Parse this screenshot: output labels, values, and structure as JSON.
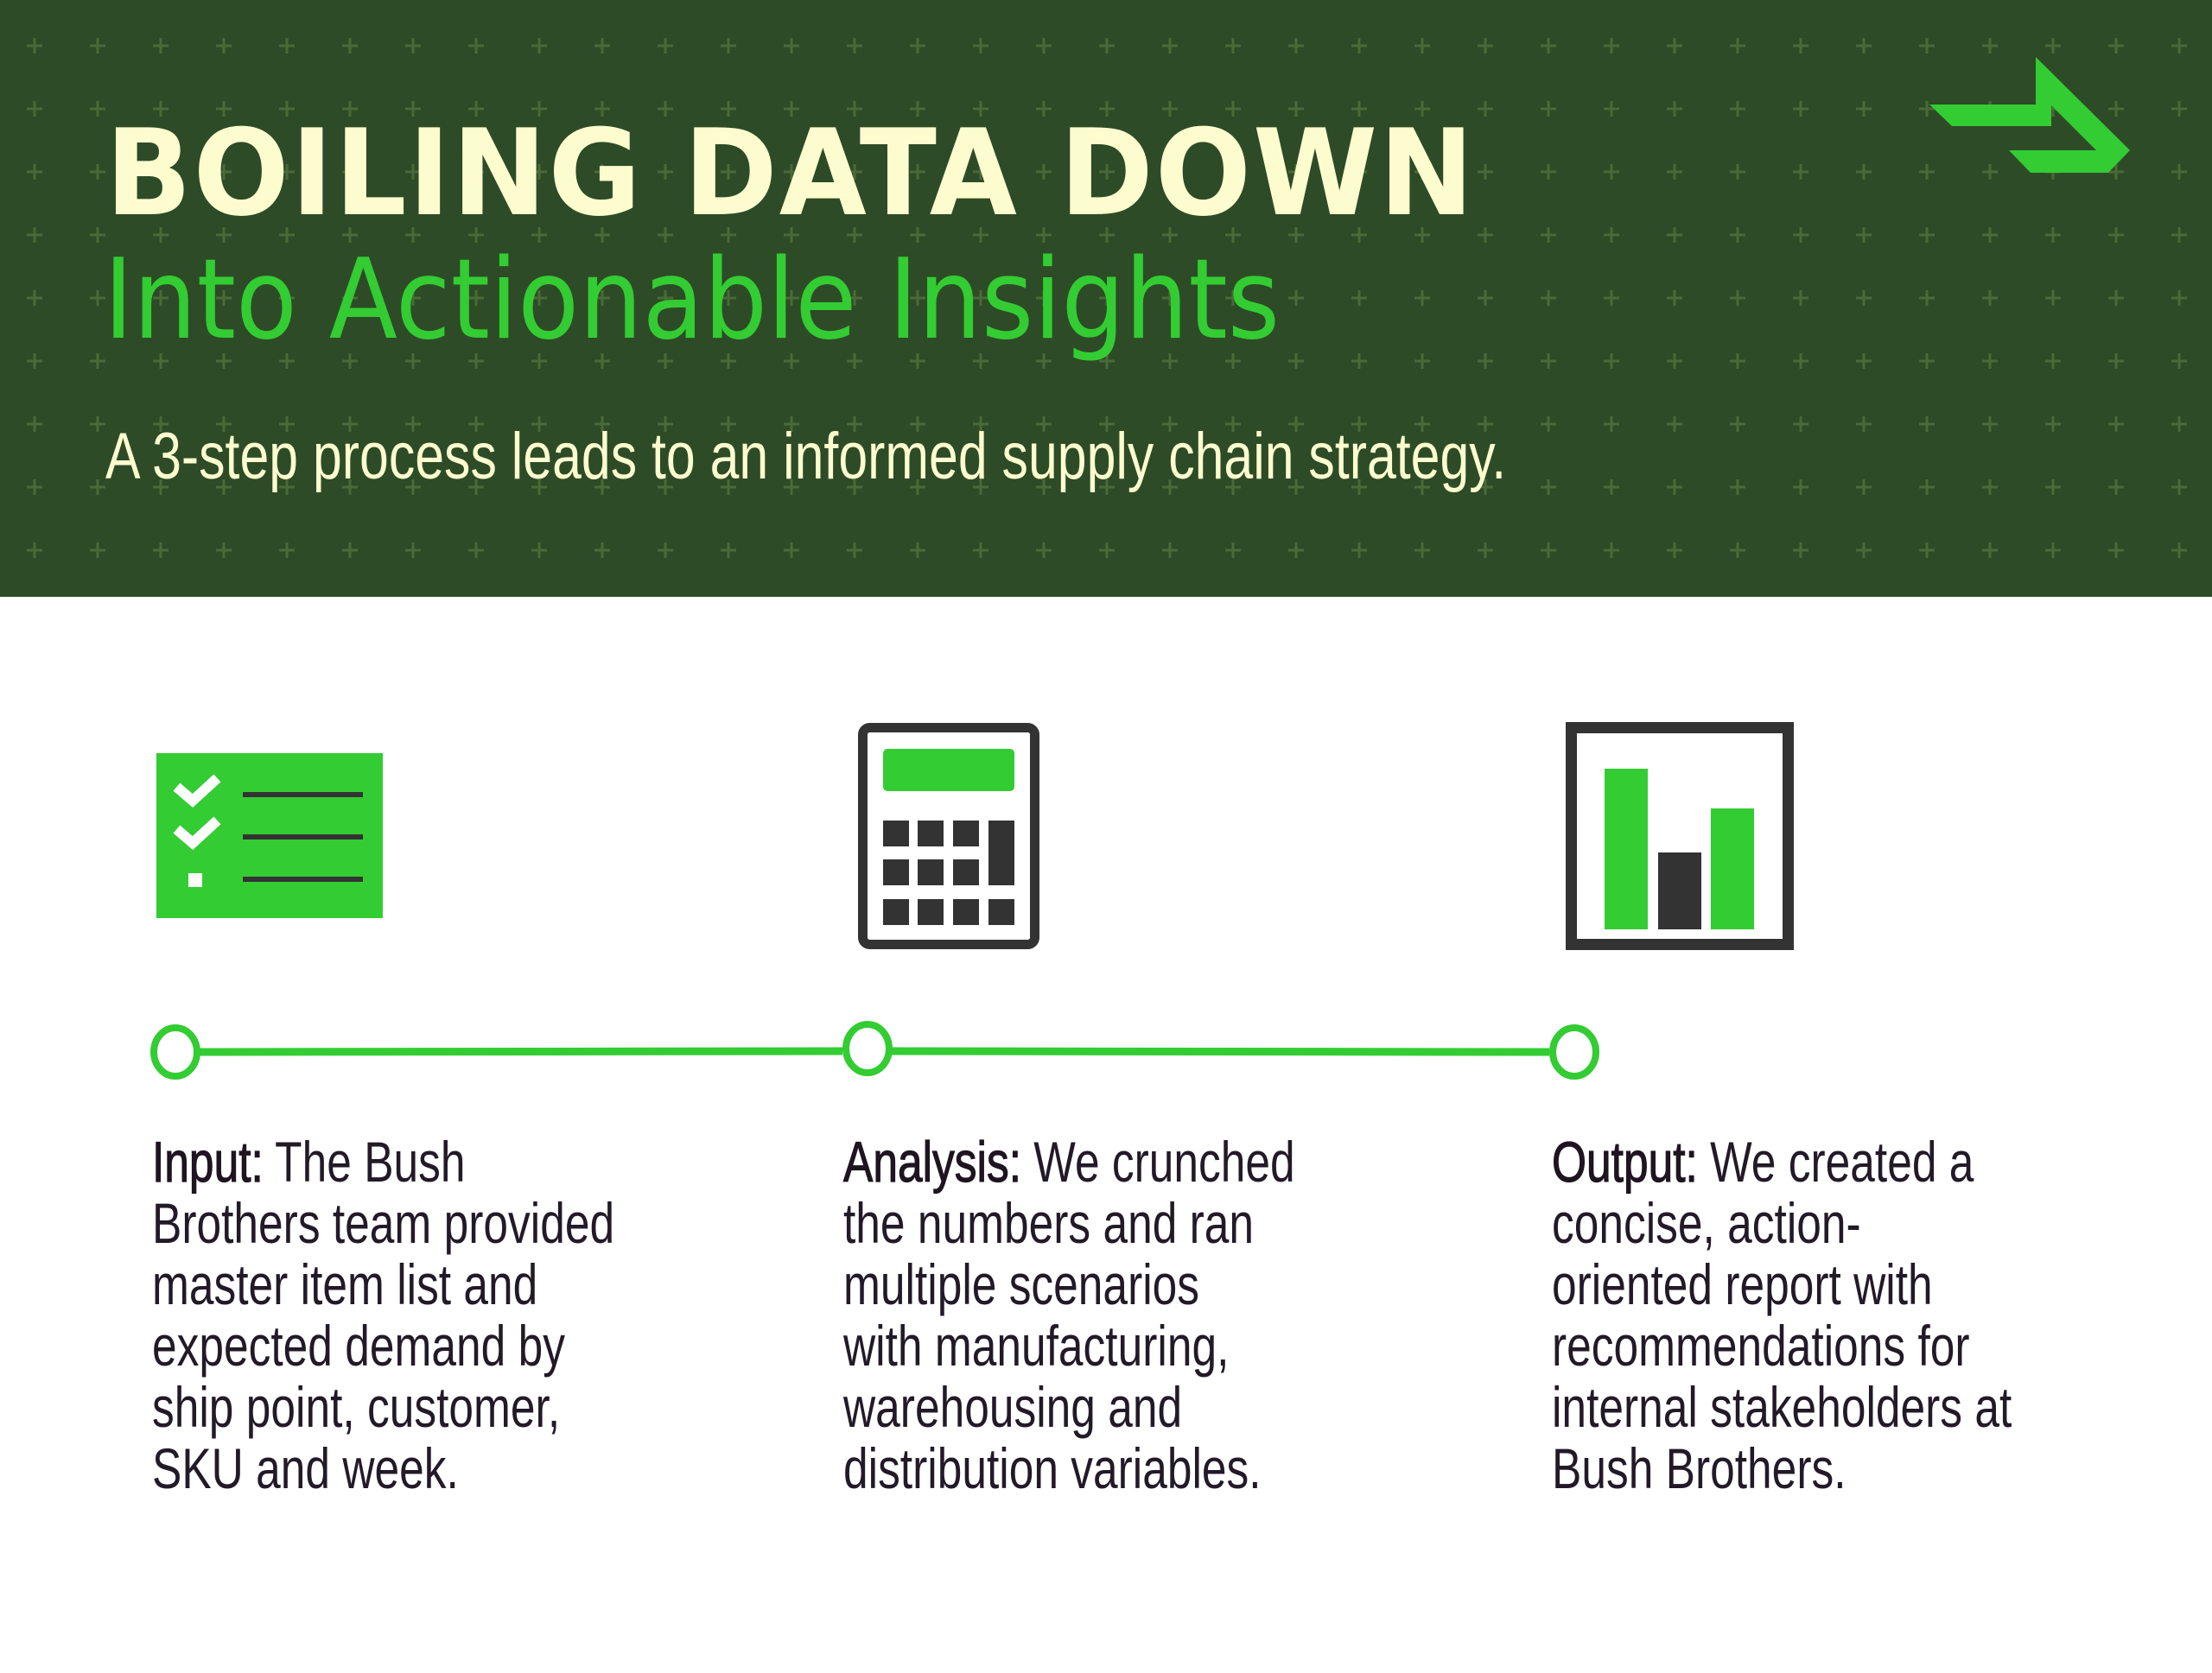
{
  "header": {
    "title": "BOILING DATA DOWN",
    "subtitle": "Into Actionable Insights",
    "tagline": "A 3-step process leads to an informed supply chain strategy.",
    "logo_icon": "arrow-logo-icon"
  },
  "colors": {
    "header_bg": "#2e4b27",
    "cream": "#fdfccf",
    "accent_green": "#33cc33",
    "icon_dark": "#333333",
    "body_text": "#231a28"
  },
  "steps": [
    {
      "icon": "checklist-icon",
      "label": "Input:",
      "first_line_rest": " The Bush",
      "lines": [
        "Brothers team provided",
        "master item list and",
        "expected demand by",
        "ship point, customer,",
        "SKU and week."
      ]
    },
    {
      "icon": "calculator-icon",
      "label": "Analysis:",
      "first_line_rest": " We crunched",
      "lines": [
        "the numbers and ran",
        "multiple scenarios",
        "with manufacturing,",
        "warehousing and",
        "distribution variables."
      ]
    },
    {
      "icon": "bar-chart-icon",
      "label": "Output:",
      "first_line_rest": " We created a",
      "lines": [
        "concise, action-",
        "oriented report with",
        "recommendations for",
        "internal stakeholders at",
        "Bush Brothers."
      ]
    }
  ]
}
